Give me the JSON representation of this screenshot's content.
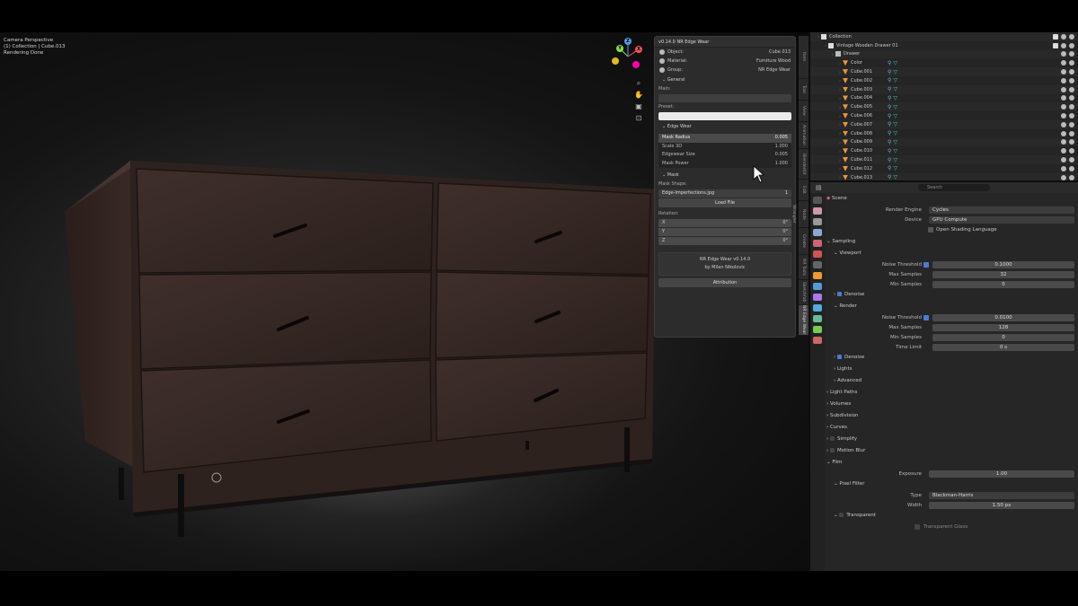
{
  "viewport": {
    "info": [
      "Camera Perspective",
      "(1) Collection | Cube.013",
      "Rendering Done"
    ],
    "gizmo": {
      "x": "X",
      "y": "Y",
      "z": "Z"
    }
  },
  "npanel": {
    "title": "v0.14.0 NR Edge Wear",
    "object_label": "Object:",
    "object_value": "Cube.013",
    "material_label": "Material:",
    "material_value": "Furniture Wood",
    "group_label": "Group:",
    "group_value": "NR Edge Wear",
    "section_general": "General",
    "main_label": "Main:",
    "preset_label": "Preset:",
    "section_edge_wear": "Edge Wear",
    "params": [
      {
        "name": "Mask Radius",
        "value": "0.005"
      },
      {
        "name": "Scale 3D",
        "value": "1.000"
      },
      {
        "name": "Edgewear Size",
        "value": "0.005"
      },
      {
        "name": "Mask Power",
        "value": "1.000"
      }
    ],
    "section_mask": "Mask",
    "mask_shape_label": "Mask Shape:",
    "mask_file": "Edge-Imperfections.jpg",
    "mask_file_users": "1",
    "load_file": "Load File",
    "rotation_label": "Rotation:",
    "rotation": [
      {
        "axis": "X",
        "value": "0°"
      },
      {
        "axis": "Y",
        "value": "0°"
      },
      {
        "axis": "Z",
        "value": "0°"
      }
    ],
    "footer_line1": "NR Edge Wear v0.14.0",
    "footer_line2": "by Milan Nikolovic",
    "attribution": "Attribution"
  },
  "vtabs": [
    "Item",
    "Tool",
    "View",
    "Animation",
    "BlenderKit",
    "Edit",
    "Node Wrangler",
    "Create",
    "NR Tools",
    "Sketchfab",
    "NR Edge Wear"
  ],
  "outliner": {
    "rows": [
      {
        "name": "Collection",
        "depth": 0,
        "kind": "collection"
      },
      {
        "name": "Vintage Wooden Drawer 01",
        "depth": 1,
        "kind": "collection"
      },
      {
        "name": "Drawer",
        "depth": 2,
        "kind": "empty"
      },
      {
        "name": "Color",
        "depth": 3,
        "kind": "mesh"
      },
      {
        "name": "Cube.001",
        "depth": 3,
        "kind": "mesh"
      },
      {
        "name": "Cube.002",
        "depth": 3,
        "kind": "mesh"
      },
      {
        "name": "Cube.003",
        "depth": 3,
        "kind": "mesh"
      },
      {
        "name": "Cube.004",
        "depth": 3,
        "kind": "mesh"
      },
      {
        "name": "Cube.005",
        "depth": 3,
        "kind": "mesh"
      },
      {
        "name": "Cube.006",
        "depth": 3,
        "kind": "mesh"
      },
      {
        "name": "Cube.007",
        "depth": 3,
        "kind": "mesh"
      },
      {
        "name": "Cube.008",
        "depth": 3,
        "kind": "mesh"
      },
      {
        "name": "Cube.009",
        "depth": 3,
        "kind": "mesh"
      },
      {
        "name": "Cube.010",
        "depth": 3,
        "kind": "mesh"
      },
      {
        "name": "Cube.011",
        "depth": 3,
        "kind": "mesh"
      },
      {
        "name": "Cube.012",
        "depth": 3,
        "kind": "mesh"
      },
      {
        "name": "Cube.013",
        "depth": 3,
        "kind": "mesh"
      }
    ]
  },
  "properties": {
    "search_placeholder": "Search",
    "scene": "Scene",
    "render_engine_label": "Render Engine",
    "render_engine": "Cycles",
    "device_label": "Device",
    "device": "GPU Compute",
    "osl": "Open Shading Language",
    "sampling": "Sampling",
    "viewport": "Viewport",
    "vp_noise_threshold_label": "Noise Threshold",
    "vp_noise_threshold": "0.1000",
    "vp_max_samples_label": "Max Samples",
    "vp_max_samples": "32",
    "vp_min_samples_label": "Min Samples",
    "vp_min_samples": "0",
    "denoise": "Denoise",
    "render": "Render",
    "r_noise_threshold_label": "Noise Threshold",
    "r_noise_threshold": "0.0100",
    "r_max_samples_label": "Max Samples",
    "r_max_samples": "128",
    "r_min_samples_label": "Min Samples",
    "r_min_samples": "0",
    "r_time_limit_label": "Time Limit",
    "r_time_limit": "0 s",
    "denoise2": "Denoise",
    "lights": "Lights",
    "advanced": "Advanced",
    "light_paths": "Light Paths",
    "volumes": "Volumes",
    "subdivision": "Subdivision",
    "curves": "Curves",
    "simplify": "Simplify",
    "motion_blur": "Motion Blur",
    "film": "Film",
    "exposure_label": "Exposure",
    "exposure": "1.00",
    "pixel_filter": "Pixel Filter",
    "type_label": "Type",
    "type": "Blackman-Harris",
    "width_label": "Width",
    "width": "1.50 px",
    "transparent": "Transparent",
    "transparent_glass": "Transparent Glass"
  },
  "colors": {
    "accent": "#4a7bd4",
    "panel_bg": "#2c2c2c",
    "wood": "#3a2a24"
  }
}
